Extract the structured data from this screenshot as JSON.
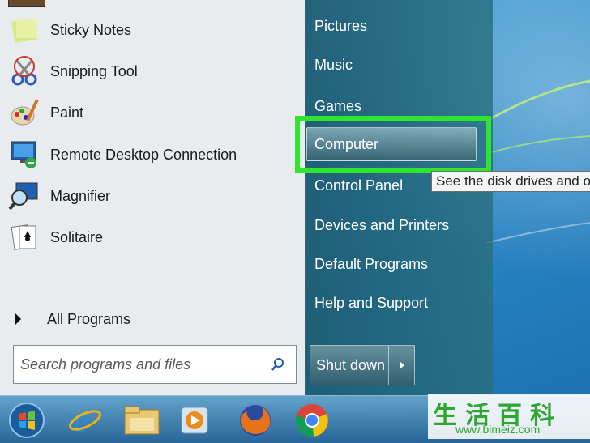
{
  "start_menu": {
    "programs": [
      {
        "label": "Sticky Notes",
        "icon": "sticky-notes-icon"
      },
      {
        "label": "Snipping Tool",
        "icon": "snipping-tool-icon"
      },
      {
        "label": "Paint",
        "icon": "paint-icon"
      },
      {
        "label": "Remote Desktop Connection",
        "icon": "remote-desktop-icon"
      },
      {
        "label": "Magnifier",
        "icon": "magnifier-icon"
      },
      {
        "label": "Solitaire",
        "icon": "solitaire-icon"
      }
    ],
    "all_programs_label": "All Programs",
    "search": {
      "placeholder": "Search programs and files",
      "value": ""
    },
    "right_items": [
      {
        "label": "Pictures"
      },
      {
        "label": "Music"
      },
      {
        "label": "Games"
      },
      {
        "label": "Computer"
      },
      {
        "label": "Control Panel"
      },
      {
        "label": "Devices and Printers"
      },
      {
        "label": "Default Programs"
      },
      {
        "label": "Help and Support"
      }
    ],
    "shutdown_label": "Shut down",
    "tooltip": "See the disk drives and o"
  },
  "taskbar": {
    "items": [
      {
        "icon": "windows-start-icon"
      },
      {
        "icon": "internet-explorer-icon"
      },
      {
        "icon": "file-explorer-icon"
      },
      {
        "icon": "media-player-icon"
      },
      {
        "icon": "firefox-icon"
      },
      {
        "icon": "chrome-icon"
      }
    ]
  },
  "watermark": {
    "chars": "生活百科",
    "url": "www.bimeiz.com"
  },
  "colors": {
    "highlight": "#2ee62e",
    "left_pane_bg": "#e9ecef"
  }
}
